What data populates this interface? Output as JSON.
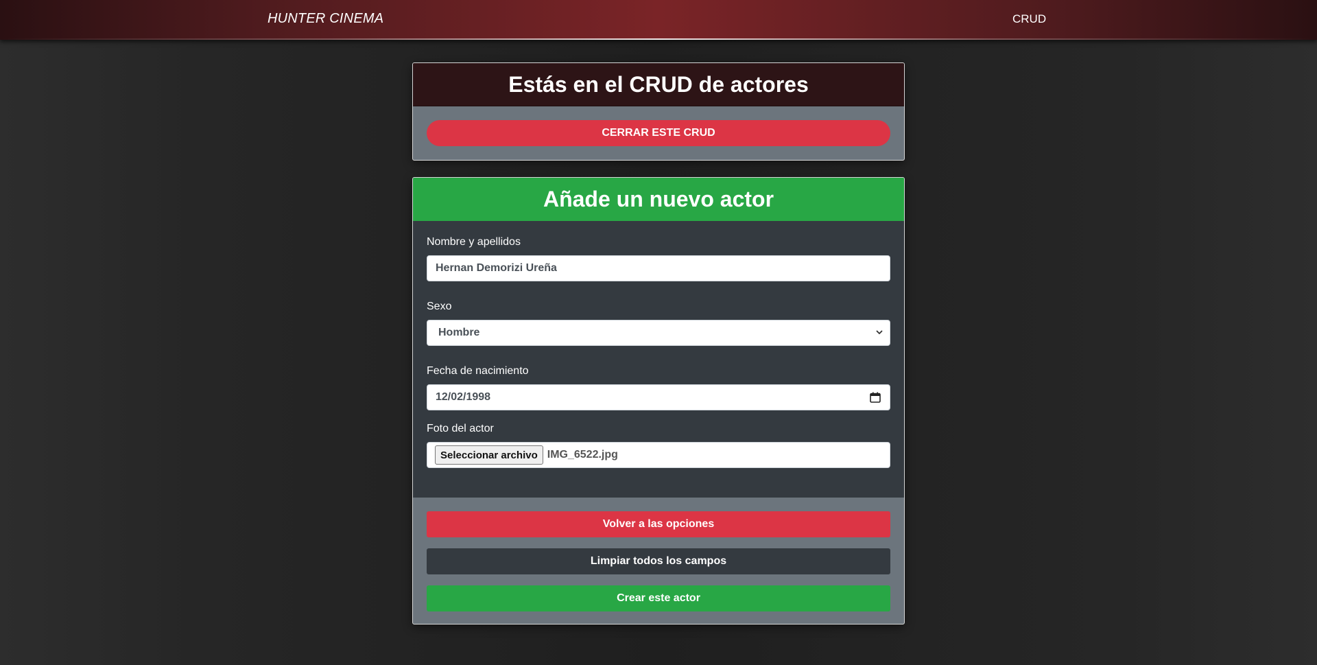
{
  "navbar": {
    "brand": "HUNTER CINEMA",
    "link": "CRUD"
  },
  "crud_card": {
    "title": "Estás en el CRUD de actores",
    "close_button": "CERRAR ESTE CRUD"
  },
  "form_card": {
    "title": "Añade un nuevo actor",
    "name_label": "Nombre y apellidos",
    "name_value": "Hernan Demorizi Ureña",
    "sex_label": "Sexo",
    "sex_value": "Hombre",
    "birth_label": "Fecha de nacimiento",
    "birth_value": "12/02/1998",
    "photo_label": "Foto del actor",
    "photo_button": "Seleccionar archivo",
    "photo_filename": "IMG_6522.jpg",
    "back_button": "Volver a las opciones",
    "clear_button": "Limpiar todos los campos",
    "create_button": "Crear este actor"
  },
  "icons": {
    "select": "chevron-down-icon",
    "date": "calendar-icon"
  },
  "colors": {
    "danger": "#dc3545",
    "success": "#28a745",
    "dark": "#343a40",
    "secondary": "#6c757d"
  }
}
